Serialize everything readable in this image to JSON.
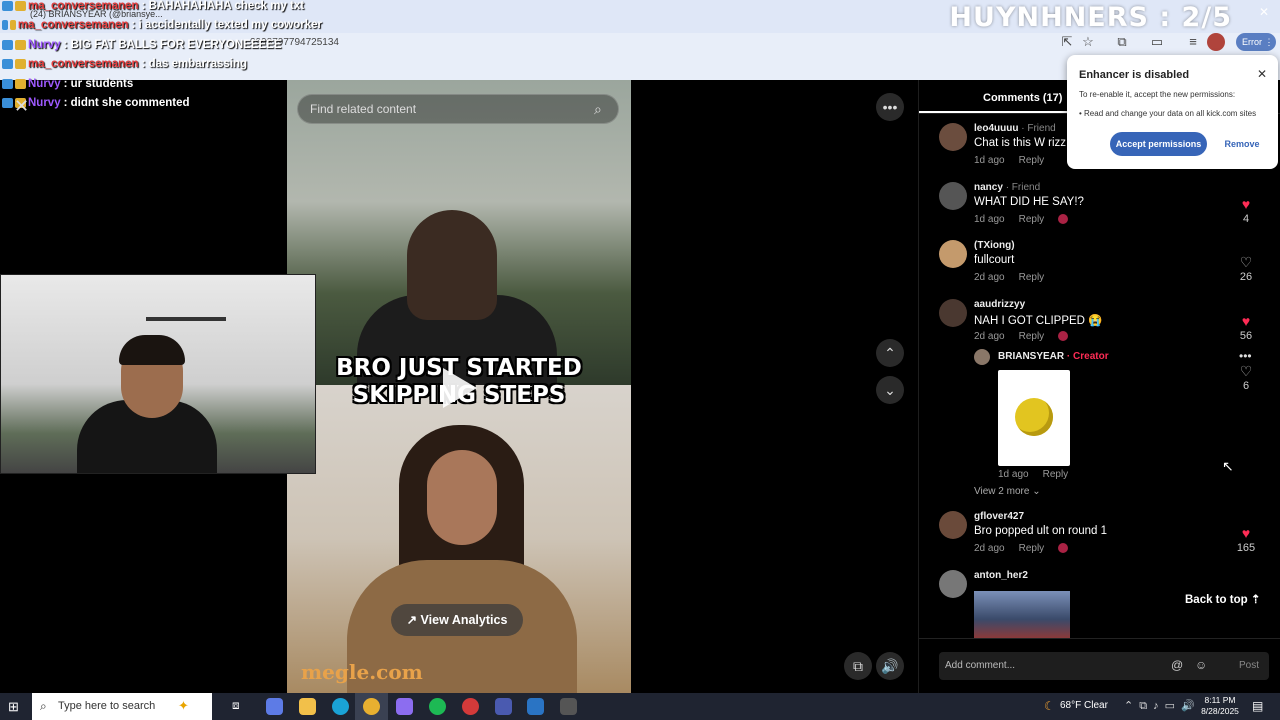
{
  "browser": {
    "tab_title": "(24) BRIANSYEAR (@briansye...",
    "url": "2998797794725134",
    "error_label": "Error"
  },
  "overlay": {
    "score": "HUYNHNERS : 2/5"
  },
  "chat": [
    {
      "user": "ma_conversemanen",
      "user_color": "#e23c3c",
      "message": "BAHAHAHAHA check my txt"
    },
    {
      "user": "ma_conversemanen",
      "user_color": "#e23c3c",
      "message": "i accidentally texted my coworker"
    },
    {
      "user": "Nurvy",
      "user_color": "#9e59ff",
      "message": "BIG FAT BALLS FOR EVERYONEEEEE"
    },
    {
      "user": "ma_conversemanen",
      "user_color": "#e23c3c",
      "message": "das embarrassing"
    },
    {
      "user": "Nurvy",
      "user_color": "#9e59ff",
      "message": "ur students"
    },
    {
      "user": "Nurvy",
      "user_color": "#9e59ff",
      "message": "didnt she commented"
    }
  ],
  "video": {
    "search_placeholder": "Find related content",
    "caption_line1": "BRO JUST STARTED",
    "caption_line2": "SKIPPING STEPS",
    "analytics_label": "View Analytics",
    "watermark": "megle.com"
  },
  "comments": {
    "tab_label": "Comments (17)",
    "items": [
      {
        "user": "leo4uuuu",
        "tag": "· Friend",
        "text": "Chat is this W rizz",
        "time": "1d ago",
        "reply": "Reply",
        "liked": false,
        "likes": ""
      },
      {
        "user": "nancy",
        "tag": "· Friend",
        "text": "WHAT DID HE SAY!?",
        "time": "1d ago",
        "reply": "Reply",
        "liked": true,
        "likes": "4"
      },
      {
        "user": "(TXiong)",
        "tag": "",
        "text": "fullcourt",
        "time": "2d ago",
        "reply": "Reply",
        "liked": false,
        "likes": "26"
      },
      {
        "user": "aaudrizzyy",
        "tag": "",
        "text": "NAH I GOT CLIPPED 😭",
        "time": "2d ago",
        "reply": "Reply",
        "liked": true,
        "likes": "56"
      },
      {
        "user": "gflover427",
        "tag": "",
        "text": "Bro popped ult on round 1",
        "time": "2d ago",
        "reply": "Reply",
        "liked": true,
        "likes": "165"
      },
      {
        "user": "anton_her2",
        "tag": "",
        "text": "",
        "time": "",
        "reply": "",
        "liked": false,
        "likes": ""
      }
    ],
    "reply": {
      "user": "BRIANSYEAR",
      "tag": "· Creator",
      "time": "1d ago",
      "reply": "Reply",
      "likes": "6"
    },
    "view_more": "View 2 more",
    "back_to_top": "Back to top",
    "add_placeholder": "Add comment...",
    "post_label": "Post"
  },
  "extension_popup": {
    "title": "Enhancer is disabled",
    "body1": "To re-enable it, accept the new permissions:",
    "body2": "• Read and change your data on all kick.com sites",
    "accept": "Accept permissions",
    "remove": "Remove"
  },
  "taskbar": {
    "search_placeholder": "Type here to search",
    "weather": "68°F  Clear",
    "time": "8:11 PM",
    "date": "8/28/2025"
  },
  "colors": {
    "accent_red": "#fe2c55",
    "ext_blue": "#3765b8"
  }
}
